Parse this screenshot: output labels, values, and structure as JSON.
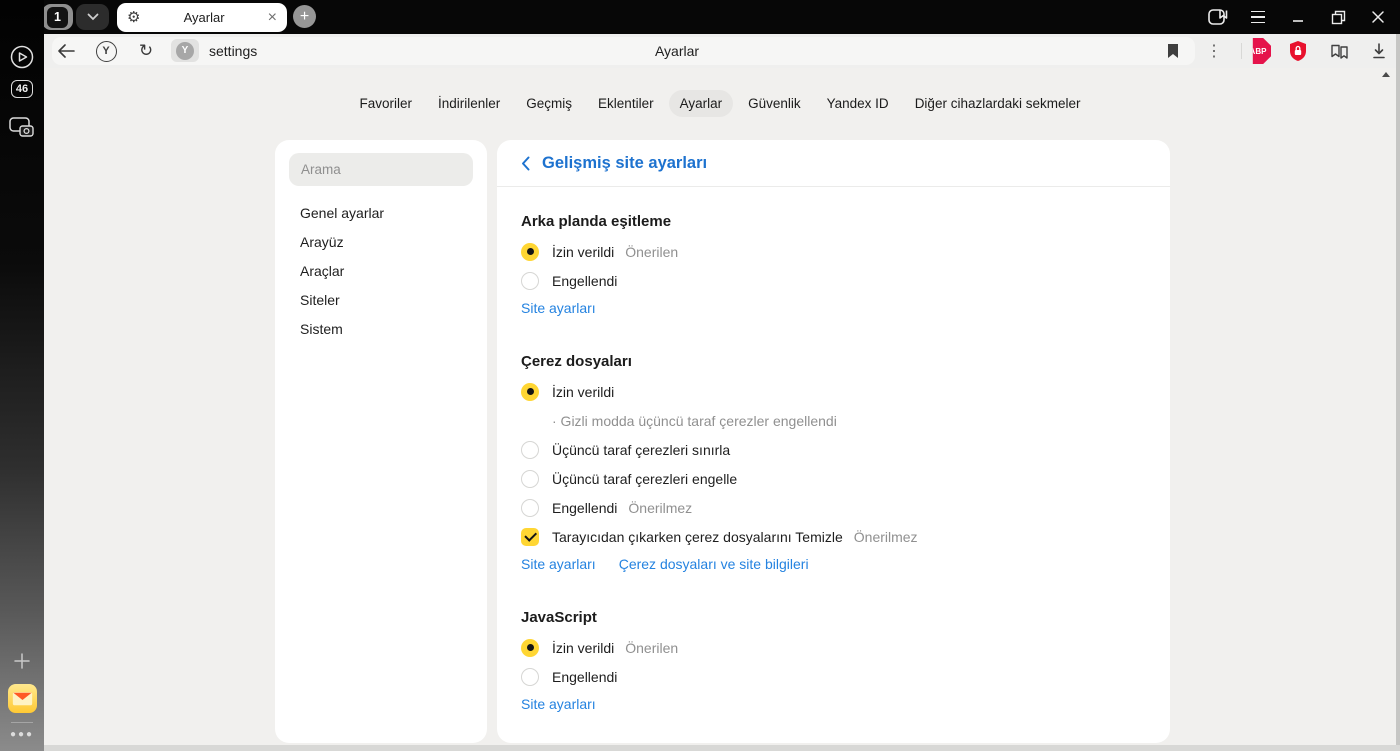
{
  "tab_bar": {
    "tab_count": "1",
    "active_tab_title": "Ayarlar"
  },
  "toolbar": {
    "url_text": "settings",
    "page_title": "Ayarlar",
    "abp_label": "ABP",
    "favicon_letter": "Y",
    "yandex_button_letter": "Y"
  },
  "side_rail": {
    "tabs_badge": "46"
  },
  "nav_tabs": {
    "items": [
      {
        "label": "Favoriler",
        "active": false
      },
      {
        "label": "İndirilenler",
        "active": false
      },
      {
        "label": "Geçmiş",
        "active": false
      },
      {
        "label": "Eklentiler",
        "active": false
      },
      {
        "label": "Ayarlar",
        "active": true
      },
      {
        "label": "Güvenlik",
        "active": false
      },
      {
        "label": "Yandex ID",
        "active": false
      },
      {
        "label": "Diğer cihazlardaki sekmeler",
        "active": false
      }
    ]
  },
  "sidebar": {
    "search_placeholder": "Arama",
    "items": [
      "Genel ayarlar",
      "Arayüz",
      "Araçlar",
      "Siteler",
      "Sistem"
    ]
  },
  "content": {
    "header_title": "Gelişmiş site ayarları",
    "sections": [
      {
        "title": "Arka planda eşitleme",
        "rows": [
          {
            "type": "radio",
            "checked": true,
            "label": "İzin verildi",
            "note": "Önerilen"
          },
          {
            "type": "radio",
            "checked": false,
            "label": "Engellendi"
          }
        ],
        "links": [
          "Site ayarları"
        ]
      },
      {
        "title": "Çerez dosyaları",
        "rows": [
          {
            "type": "radio",
            "checked": true,
            "label": "İzin verildi"
          },
          {
            "type": "helper",
            "label": "· Gizli modda üçüncü taraf çerezler engellendi"
          },
          {
            "type": "radio",
            "checked": false,
            "label": "Üçüncü taraf çerezleri sınırla"
          },
          {
            "type": "radio",
            "checked": false,
            "label": "Üçüncü taraf çerezleri engelle"
          },
          {
            "type": "radio",
            "checked": false,
            "label": "Engellendi",
            "note": "Önerilmez"
          },
          {
            "type": "checkbox",
            "checked": true,
            "label": "Tarayıcıdan çıkarken çerez dosyalarını Temizle",
            "note": "Önerilmez"
          }
        ],
        "links": [
          "Site ayarları",
          "Çerez dosyaları ve site bilgileri"
        ]
      },
      {
        "title": "JavaScript",
        "rows": [
          {
            "type": "radio",
            "checked": true,
            "label": "İzin verildi",
            "note": "Önerilen"
          },
          {
            "type": "radio",
            "checked": false,
            "label": "Engellendi"
          }
        ],
        "links": [
          "Site ayarları"
        ]
      }
    ]
  },
  "colors": {
    "accent_yellow": "#ffd633",
    "link_blue": "#2583e0",
    "header_blue": "#1d72cf",
    "abp_red": "#e5134b",
    "shield_red": "#e8112d"
  }
}
